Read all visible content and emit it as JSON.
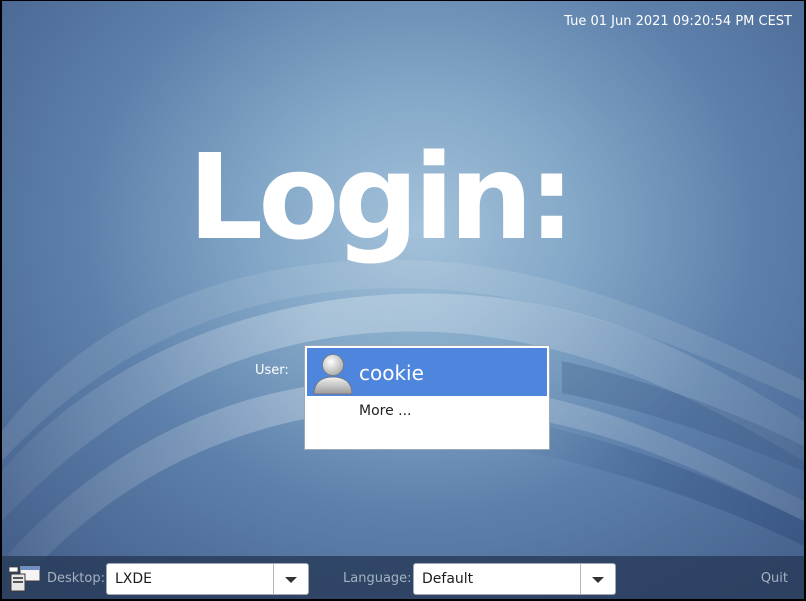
{
  "clock": {
    "text": "Tue 01 Jun 2021 09:20:54 PM CEST"
  },
  "greeting": {
    "title": "Login:"
  },
  "user_prompt": {
    "label": "User:"
  },
  "users": [
    {
      "name": "cookie",
      "selected": true,
      "icon": "user-avatar-icon"
    }
  ],
  "more_option": {
    "label": "More ..."
  },
  "bottom_bar": {
    "session_icon": "session-icon",
    "desktop": {
      "label": "Desktop:",
      "value": "LXDE"
    },
    "language": {
      "label": "Language:",
      "value": "Default"
    },
    "quit_label": "Quit"
  },
  "colors": {
    "selection": "#4e86de",
    "background": "#6d90b8",
    "bar": "#263856",
    "muted_text": "#a6b1c0"
  }
}
